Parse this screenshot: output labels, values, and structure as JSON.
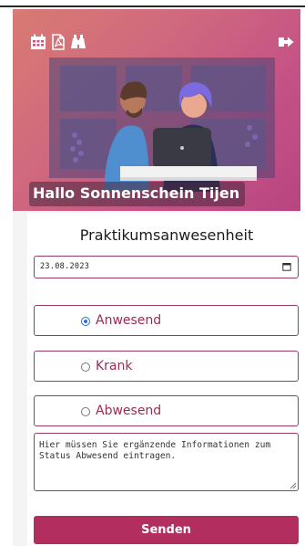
{
  "header": {
    "greeting": "Hallo Sonnenschein Tijen",
    "icons": [
      "calendar-icon",
      "pdf-icon",
      "binoculars-icon",
      "logout-icon"
    ]
  },
  "form": {
    "title": "Praktikumsanwesenheit",
    "date_value": "23.08.2023",
    "options": [
      {
        "label": "Anwesend",
        "checked": true
      },
      {
        "label": "Krank",
        "checked": false
      },
      {
        "label": "Abwesend",
        "checked": false
      }
    ],
    "note_text": "Hier müssen Sie ergänzende Informationen zum Status Abwesend eintragen.",
    "submit_label": "Senden"
  },
  "colors": {
    "brand": "#b22e5f",
    "border": "#9b3a66",
    "radio_accent": "#2a6fd6"
  }
}
